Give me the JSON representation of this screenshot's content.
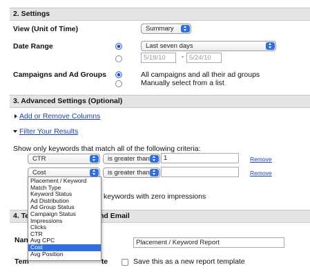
{
  "section2": {
    "title": "2. Settings",
    "view_label": "View (Unit of Time)",
    "view_value": "Summary",
    "date_range_label": "Date Range",
    "date_range_value": "Last seven days",
    "date_from": "5/18/10",
    "date_separator": "-",
    "date_to": "5/24/10",
    "campaigns_label": "Campaigns and Ad Groups",
    "campaigns_option_1": "All campaigns and all their ad groups",
    "campaigns_option_2": "Manually select from a list"
  },
  "section3": {
    "title": "3. Advanced Settings (Optional)",
    "add_remove_columns": "Add or Remove Columns",
    "filter_results": "Filter Your Results",
    "criteria_intro": "Show only keywords that match all of the following criteria:",
    "filters": [
      {
        "field": "CTR",
        "operator": "is greater than",
        "value": "1",
        "remove": "Remove"
      },
      {
        "field": "Cost",
        "operator": "is greater than",
        "value": "",
        "remove": "Remove"
      }
    ],
    "zero_impressions_text": "keywords with zero impressions"
  },
  "dropdown": {
    "options": [
      "Placement / Keyword",
      "Match Type",
      "Keyword Status",
      "Ad Distribution",
      "Ad Group Status",
      "Campaign Status",
      "Impressions",
      "Clicks",
      "CTR",
      "Avg CPC",
      "Cost",
      "Avg Position"
    ],
    "selected": "Cost"
  },
  "section4": {
    "title_left": "4. Te",
    "title_right": "nd Email",
    "name_label_partial": "Nan",
    "report_name_value": "Placement / Keyword Report",
    "template_label_partial": "Tem",
    "template_label_partial_2": "te",
    "save_template_text": "Save this as a new report template"
  },
  "colors": {
    "header_bg": "#e4e4e4",
    "link": "#1a3fb5",
    "accent_blue": "#2f6fe0"
  }
}
